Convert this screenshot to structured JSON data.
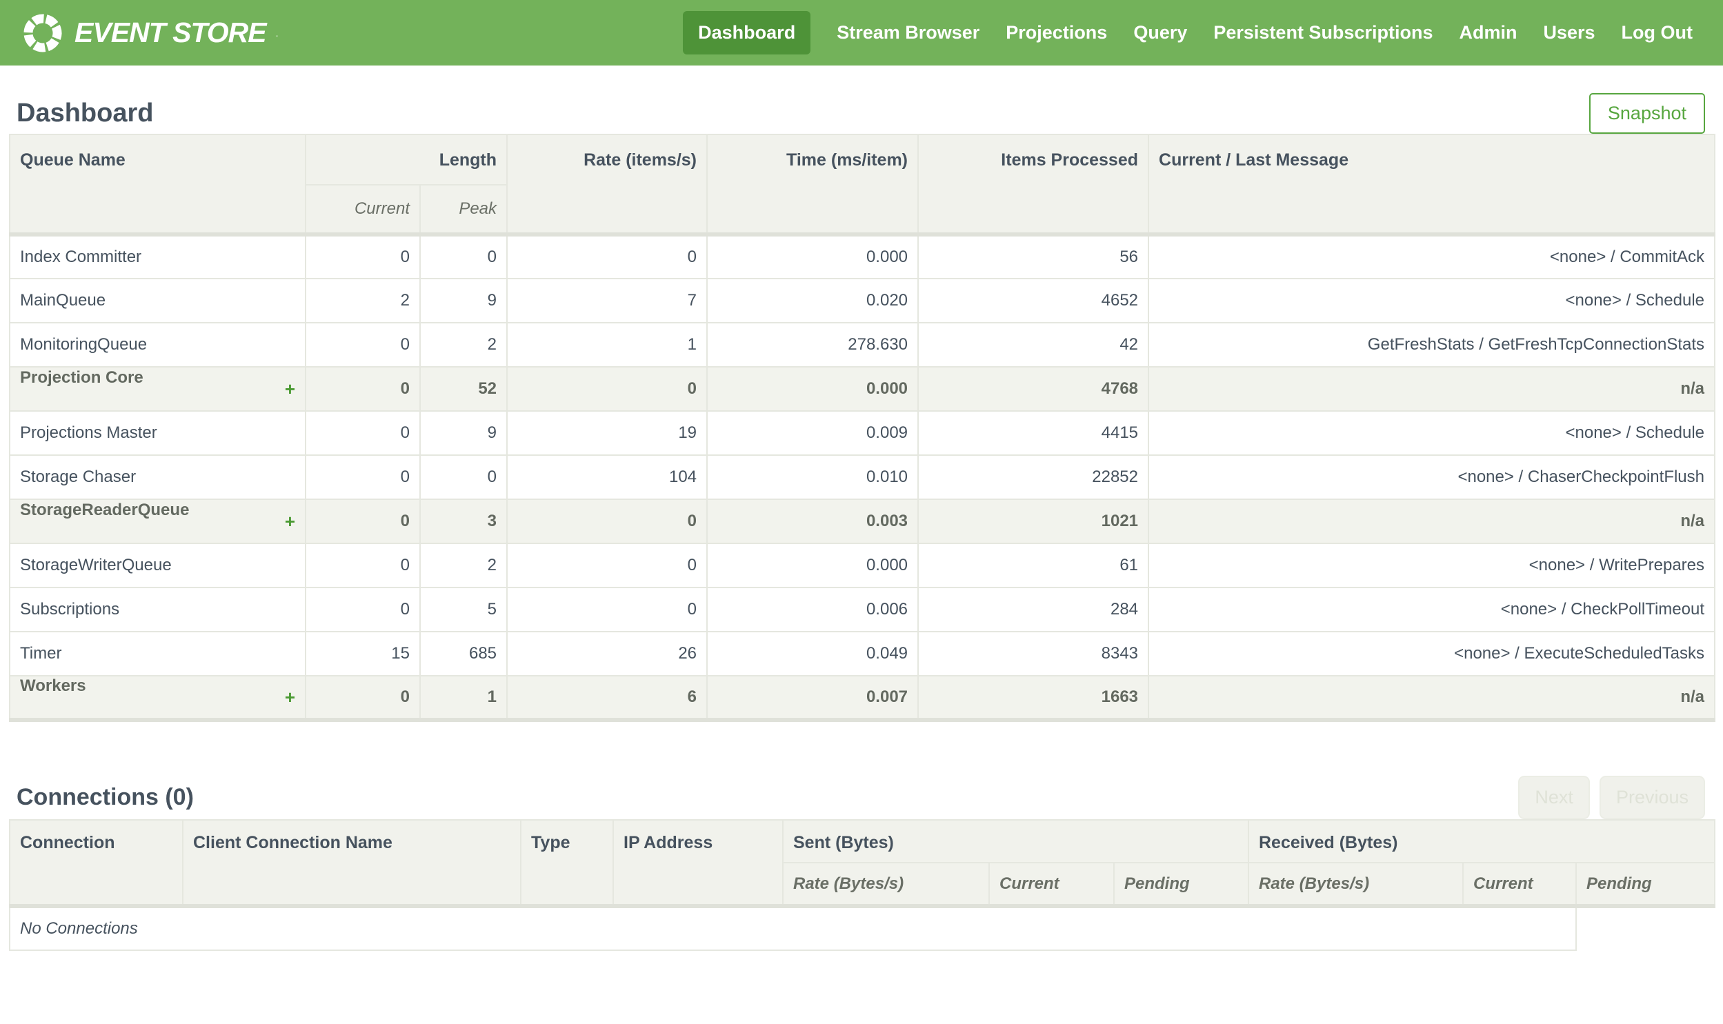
{
  "colors": {
    "brand_green": "#73B25A",
    "active_tab_green": "#4E9338",
    "accent_green": "#57A63F",
    "plus_green": "#4B9A33",
    "header_bg": "#F1F2EC",
    "group_row_bg": "#F2F3ED",
    "border": "#E5E7DF",
    "text_dark": "#46525E",
    "disabled_text": "#DFE2D7"
  },
  "nav": {
    "brand": {
      "name": "EVENT STORE",
      "tm": "."
    },
    "items": [
      {
        "label": "Dashboard",
        "active": true
      },
      {
        "label": "Stream Browser",
        "active": false
      },
      {
        "label": "Projections",
        "active": false
      },
      {
        "label": "Query",
        "active": false
      },
      {
        "label": "Persistent Subscriptions",
        "active": false
      },
      {
        "label": "Admin",
        "active": false
      },
      {
        "label": "Users",
        "active": false
      },
      {
        "label": "Log Out",
        "active": false
      }
    ]
  },
  "page": {
    "title": "Dashboard",
    "snapshot_label": "Snapshot"
  },
  "queue_table": {
    "expand_symbol": "+",
    "headers": {
      "queue_name": "Queue Name",
      "length": "Length",
      "current": "Current",
      "peak": "Peak",
      "rate": "Rate (items/s)",
      "time": "Time (ms/item)",
      "items_processed": "Items Processed",
      "message": "Current / Last Message"
    },
    "rows": [
      {
        "name": "Index Committer",
        "group": false,
        "current": "0",
        "peak": "0",
        "rate": "0",
        "time": "0.000",
        "items": "56",
        "message": "<none> / CommitAck"
      },
      {
        "name": "MainQueue",
        "group": false,
        "current": "2",
        "peak": "9",
        "rate": "7",
        "time": "0.020",
        "items": "4652",
        "message": "<none> / Schedule"
      },
      {
        "name": "MonitoringQueue",
        "group": false,
        "current": "0",
        "peak": "2",
        "rate": "1",
        "time": "278.630",
        "items": "42",
        "message": "GetFreshStats / GetFreshTcpConnectionStats"
      },
      {
        "name": "Projection Core",
        "group": true,
        "current": "0",
        "peak": "52",
        "rate": "0",
        "time": "0.000",
        "items": "4768",
        "message": "n/a"
      },
      {
        "name": "Projections Master",
        "group": false,
        "current": "0",
        "peak": "9",
        "rate": "19",
        "time": "0.009",
        "items": "4415",
        "message": "<none> / Schedule"
      },
      {
        "name": "Storage Chaser",
        "group": false,
        "current": "0",
        "peak": "0",
        "rate": "104",
        "time": "0.010",
        "items": "22852",
        "message": "<none> / ChaserCheckpointFlush"
      },
      {
        "name": "StorageReaderQueue",
        "group": true,
        "current": "0",
        "peak": "3",
        "rate": "0",
        "time": "0.003",
        "items": "1021",
        "message": "n/a"
      },
      {
        "name": "StorageWriterQueue",
        "group": false,
        "current": "0",
        "peak": "2",
        "rate": "0",
        "time": "0.000",
        "items": "61",
        "message": "<none> / WritePrepares"
      },
      {
        "name": "Subscriptions",
        "group": false,
        "current": "0",
        "peak": "5",
        "rate": "0",
        "time": "0.006",
        "items": "284",
        "message": "<none> / CheckPollTimeout"
      },
      {
        "name": "Timer",
        "group": false,
        "current": "15",
        "peak": "685",
        "rate": "26",
        "time": "0.049",
        "items": "8343",
        "message": "<none> / ExecuteScheduledTasks"
      },
      {
        "name": "Workers",
        "group": true,
        "current": "0",
        "peak": "1",
        "rate": "6",
        "time": "0.007",
        "items": "1663",
        "message": "n/a"
      }
    ]
  },
  "connections": {
    "title": "Connections (0)",
    "next_label": "Next",
    "previous_label": "Previous",
    "headers": {
      "connection": "Connection",
      "client_connection_name": "Client Connection Name",
      "type": "Type",
      "ip_address": "IP Address",
      "sent": "Sent (Bytes)",
      "received": "Received (Bytes)",
      "rate": "Rate (Bytes/s)",
      "current": "Current",
      "pending": "Pending"
    },
    "empty_message": "No Connections"
  }
}
